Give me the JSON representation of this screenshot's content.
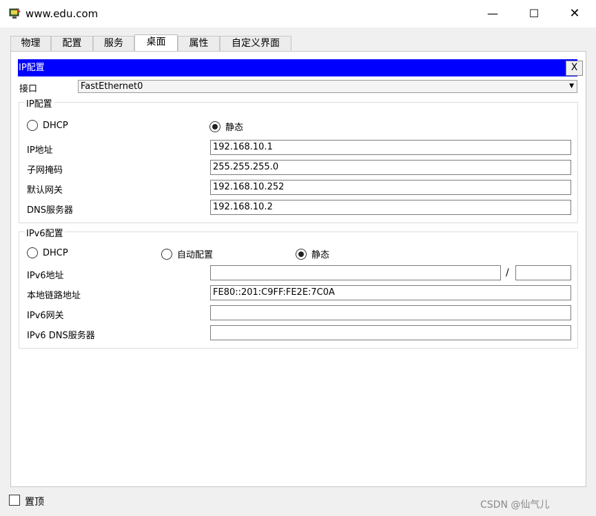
{
  "window": {
    "title": "www.edu.com",
    "minimize": "—",
    "maximize": "☐",
    "close": "✕"
  },
  "tabs": [
    {
      "label": "物理"
    },
    {
      "label": "配置"
    },
    {
      "label": "服务"
    },
    {
      "label": "桌面",
      "active": true
    },
    {
      "label": "属性"
    },
    {
      "label": "自定义界面"
    }
  ],
  "ip_panel": {
    "title": "IP配置",
    "close": "X",
    "interface_label": "接口",
    "interface_value": "FastEthernet0"
  },
  "ipv4": {
    "group_title": "IP配置",
    "dhcp_label": "DHCP",
    "static_label": "静态",
    "mode": "static",
    "ip_label": "IP地址",
    "ip_value": "192.168.10.1",
    "mask_label": "子网掩码",
    "mask_value": "255.255.255.0",
    "gateway_label": "默认网关",
    "gateway_value": "192.168.10.252",
    "dns_label": "DNS服务器",
    "dns_value": "192.168.10.2"
  },
  "ipv6": {
    "group_title": "IPv6配置",
    "dhcp_label": "DHCP",
    "auto_label": "自动配置",
    "static_label": "静态",
    "mode": "static",
    "address_label": "IPv6地址",
    "address_value": "",
    "prefix_separator": "/",
    "prefix_value": "",
    "link_local_label": "本地链路地址",
    "link_local_value": "FE80::201:C9FF:FE2E:7C0A",
    "gateway_label": "IPv6网关",
    "gateway_value": "",
    "dns_label": "IPv6 DNS服务器",
    "dns_value": ""
  },
  "footer": {
    "pin_label": "置顶",
    "watermark": "CSDN @仙气儿"
  },
  "colors": {
    "header_bar": "#0000ff",
    "frame_bg": "#f0f0f0"
  }
}
